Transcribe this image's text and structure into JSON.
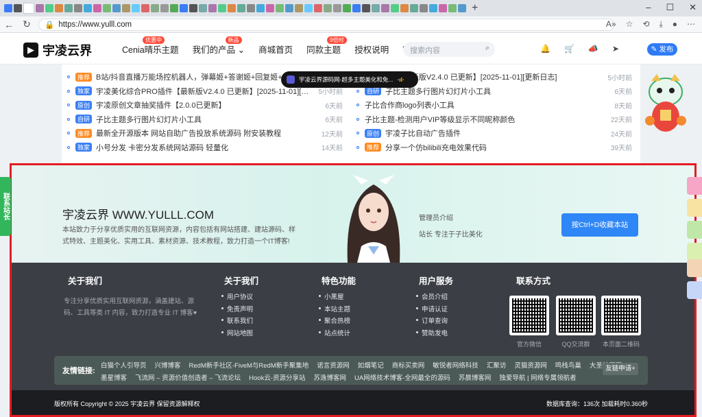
{
  "browser": {
    "url": "https://www.yulll.com",
    "window_controls": [
      "–",
      "☐",
      "✕"
    ]
  },
  "header": {
    "logo_text": "宇凌云界",
    "nav": [
      {
        "label": "Cenia晴乐主题",
        "badge": "优惠中"
      },
      {
        "label": "我们的产品",
        "badge": "新品",
        "caret": "⌄"
      },
      {
        "label": "商城首页",
        "badge": ""
      },
      {
        "label": "同款主题",
        "badge": "9倍时"
      },
      {
        "label": "授权说明",
        "badge": ""
      },
      {
        "label": "•••",
        "badge": ""
      }
    ],
    "search_placeholder": "搜索内容",
    "publish_label": "✎ 发布"
  },
  "toast": {
    "text": "宇凌云界源码网-超多主题美化和免...",
    "eq": "·ıl·"
  },
  "left_list": [
    {
      "tag": "推荐",
      "tag_color": "#ff8a1f",
      "title": "B站/抖音直播万能场控机器人，弹幕姬+答谢姬+回复姬+点歌姬+各...",
      "time": ""
    },
    {
      "tag": "独家",
      "tag_color": "#3a7ff5",
      "title": "宇凌美化综合PRO插件【最新版V2.4.0 已更新】[2025-11-01][更新日志]",
      "time": "5小时前"
    },
    {
      "tag": "原创",
      "tag_color": "#3a7ff5",
      "title": "宇凌原创文章抽奖插件【2.0.0已更新】",
      "time": "6天前"
    },
    {
      "tag": "自研",
      "tag_color": "#3a7ff5",
      "title": "子比主题多行图片幻灯片小工具",
      "time": "6天前"
    },
    {
      "tag": "推荐",
      "tag_color": "#ff8a1f",
      "title": "最新全开源版本 网站自助广告投放系统源码 附安装教程",
      "time": "12天前"
    },
    {
      "tag": "独家",
      "tag_color": "#3a7ff5",
      "title": "小号分发 卡密分发系统网站源码 轻量化",
      "time": "14天前"
    }
  ],
  "right_list": [
    {
      "tag": "",
      "tag_color": "",
      "title": "PRO插件【最新版V2.4.0 已更新】[2025-11-01][更新日志]",
      "time": "5小时前"
    },
    {
      "tag": "自研",
      "tag_color": "#3a7ff5",
      "title": "子比主题多行图片幻灯片小工具",
      "time": "6天前"
    },
    {
      "tag": "",
      "tag_color": "",
      "title": "子比合作商logo列表小工具",
      "time": "8天前"
    },
    {
      "tag": "",
      "tag_color": "",
      "title": "子比主题-检测用户VIP等级显示不同昵称颜色",
      "time": "22天前"
    },
    {
      "tag": "原创",
      "tag_color": "#3a7ff5",
      "title": "宇凌子比自动广告插件",
      "time": "24天前"
    },
    {
      "tag": "推荐",
      "tag_color": "#ff8a1f",
      "title": "分享一个仿bilibili充电效果代码",
      "time": "39天前"
    }
  ],
  "footer": {
    "brand": "宇凌云界 WWW.YULLL.COM",
    "desc": "本站致力于分享优质实用的互联网资源，内容包括有网站搭建、建站源码、样式特效、主题美化、实用工具、素材资源、技术教程，致力打造一个IT博客!",
    "admin_title": "管理员介绍",
    "admin_desc": "站长 专注于子比美化",
    "bookmark_btn": "按Ctrl+D收藏本站",
    "col_about_title": "关于我们",
    "col_about_text": "专注分享优质实用互联网资源，涵盖建站、源码、工具等类 IT 内容，致力打造专业 IT 博客♥",
    "col2_title": "关于我们",
    "col2_links": [
      "用户协议",
      "免责声明",
      "联系我们",
      "网站地图"
    ],
    "col3_title": "特色功能",
    "col3_links": [
      "小黑屋",
      "本站主题",
      "聚合热榜",
      "站点统计"
    ],
    "col4_title": "用户服务",
    "col4_links": [
      "会员介绍",
      "申请认证",
      "订单查询",
      "赞助发电"
    ],
    "col5_title": "联系方式",
    "qr_caps": [
      "官方微信",
      "QQ交流群",
      "本页面二维码"
    ],
    "friend_label": "友情链接:",
    "friend_line1": [
      "白猫个人引导页",
      "兴博博客",
      "RedM新手社区-FiveM与RedM新手聚集地",
      "诺言资源网",
      "如烟笔记",
      "商标买卖网",
      "敏锐者网络科技",
      "汇聚访",
      "灵猫资源网",
      "鸣栈鸟巢",
      "大圣社区网"
    ],
    "friend_line2": [
      "墨星博客",
      "飞流网 – 资源价值创造者 – 飞流论坛",
      "Hook云-资源分享站",
      "苏逸博客网",
      "UA网络技术博客-全网最全的源码",
      "苏晨博客网",
      "独爱导航 | 网络专属领航者"
    ],
    "friend_apply": "友链申请+",
    "copyright": "版权所有 Copyright © 2025 宇凌云界 保留资源解释权",
    "stats": "数据库查询：136次 加载耗时0.360秒"
  },
  "side_left_text": "联系站长",
  "colors": {
    "accent": "#2f7bf6",
    "frame": "#e51b23",
    "dark": "#3b3e44"
  }
}
